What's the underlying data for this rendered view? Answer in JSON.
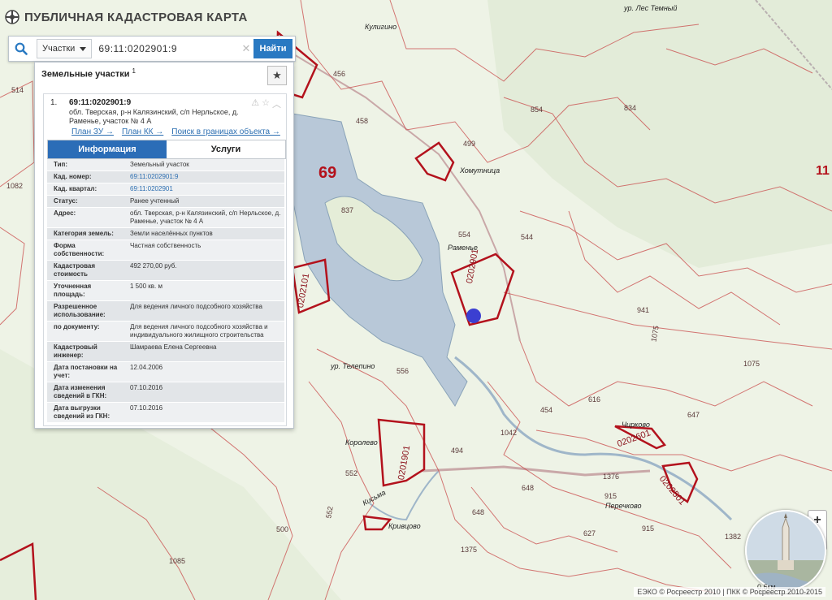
{
  "app": {
    "title": "ПУБЛИЧНАЯ КАДАСТРОВАЯ КАРТА"
  },
  "search": {
    "type_label": "Участки",
    "query": "69:11:0202901:9",
    "button": "Найти"
  },
  "panel": {
    "heading": "Земельные участки",
    "heading_count": "1",
    "result": {
      "index": "1.",
      "number": "69:11:0202901:9",
      "address": "обл. Тверская, р-н Калязинский, с/п Нерльское, д. Раменье, участок № 4 А",
      "links": [
        "План ЗУ →",
        "План КК →",
        "Поиск в границах объекта →"
      ],
      "tabs": [
        "Информация",
        "Услуги"
      ],
      "rows": [
        {
          "key": "Тип:",
          "value": "Земельный участок"
        },
        {
          "key": "Кад. номер:",
          "value": "69:11:0202901:9",
          "link": true
        },
        {
          "key": "Кад. квартал:",
          "value": "69:11:0202901",
          "link": true
        },
        {
          "key": "Статус:",
          "value": "Ранее учтенный"
        },
        {
          "key": "Адрес:",
          "value": "обл. Тверская, р-н Калязинский, с/п Нерльское, д. Раменье, участок № 4 А"
        },
        {
          "key": "Категория земель:",
          "value": "Земли населённых пунктов"
        },
        {
          "key": "Форма собственности:",
          "value": "Частная собственность"
        },
        {
          "key": "Кадастровая стоимость",
          "value": "492 270,00 руб."
        },
        {
          "key": "Уточненная площадь:",
          "value": "1 500 кв. м"
        },
        {
          "key": "Разрешенное использование:",
          "value": "Для ведения личного подсобного хозяйства"
        },
        {
          "key": "по документу:",
          "value": "Для ведения личного подсобного хозяйства и индивидуального жилищного строительства"
        },
        {
          "key": "Кадастровый инженер:",
          "value": "Шамраева Елена Сергеевна"
        },
        {
          "key": "Дата постановки на учет:",
          "value": "12.04.2006"
        },
        {
          "key": "Дата изменения сведений в ГКН:",
          "value": "07.10.2016"
        },
        {
          "key": "Дата выгрузки сведений из ГКН:",
          "value": "07.10.2016"
        }
      ]
    }
  },
  "map": {
    "places": [
      "Кулигино",
      "Хомутница",
      "Раменье",
      "ур. Телепино",
      "Королево",
      "Кривцово",
      "Перечково",
      "Чирково",
      "ур. Лес Темный",
      "Кисьма"
    ],
    "region_label": "69",
    "edge_label": "11",
    "quarters": [
      "0202901",
      "0201901",
      "0202601",
      "0202501",
      "0202101"
    ],
    "parcel_numbers": [
      "456",
      "458",
      "499",
      "854",
      "834",
      "514",
      "1082",
      "837",
      "554",
      "544",
      "941",
      "1075",
      "1075",
      "556",
      "616",
      "454",
      "647",
      "1042",
      "494",
      "552",
      "1376",
      "648",
      "915",
      "648",
      "627",
      "915",
      "552",
      "500",
      "1085",
      "1375",
      "1382"
    ],
    "scale_label": "0.6км",
    "attribution": "ЕЭКО © Росреестр 2010 | ПКК © Росреестр 2010-2015"
  },
  "colors": {
    "accent": "#2979c2",
    "boundary": "#c11a25",
    "water": "#b8c8d8",
    "land": "#eef3e6"
  }
}
